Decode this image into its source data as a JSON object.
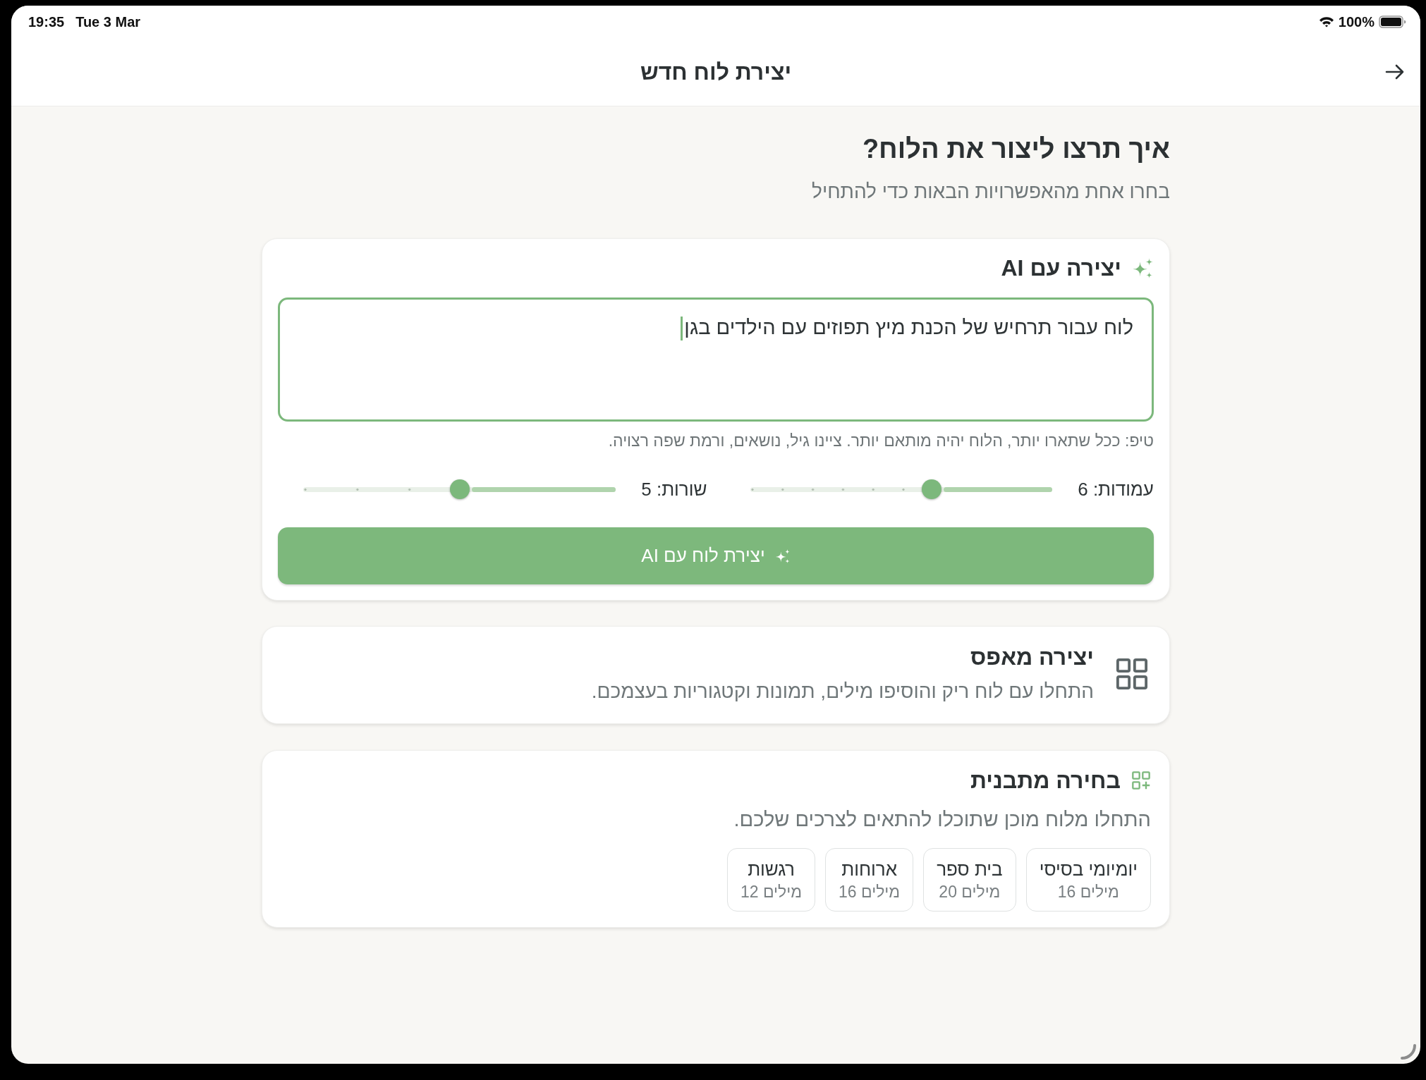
{
  "status_bar": {
    "time": "19:35",
    "date": "Tue 3 Mar",
    "battery": "100%"
  },
  "header": {
    "title": "יצירת לוח חדש"
  },
  "intro": {
    "title": "איך תרצו ליצור את הלוח?",
    "subtitle": "בחרו אחת מהאפשרויות הבאות כדי להתחיל"
  },
  "ai_card": {
    "title": "יצירה עם AI",
    "prompt": {
      "value": "לוח עבור תרחיש של הכנת מיץ תפוזים עם הילדים בגן",
      "focused": true
    },
    "tip": "טיפ: ככל שתארו יותר, הלוח יהיה מותאם יותר. ציינו גיל, נושאים, ורמת שפה רצויה.",
    "sliders": [
      {
        "label": "עמודות: 6",
        "level": 0.4
      },
      {
        "label": "שורות: 5",
        "level": 0.5
      }
    ],
    "button": "יצירת לוח עם AI"
  },
  "scratch_card": {
    "title": "יצירה מאפס",
    "description": "התחלו עם לוח ריק והוסיפו מילים, תמונות וקטגוריות בעצמכם."
  },
  "template_card": {
    "title": "בחירה מתבנית",
    "description": "התחלו מלוח מוכן שתוכלו להתאים לצרכים שלכם.",
    "templates": [
      {
        "name": "יומיומי בסיסי",
        "count": "16 מילים"
      },
      {
        "name": "בית ספר",
        "count": "20 מילים"
      },
      {
        "name": "ארוחות",
        "count": "16 מילים"
      },
      {
        "name": "רגשות",
        "count": "12 מילים"
      }
    ]
  }
}
